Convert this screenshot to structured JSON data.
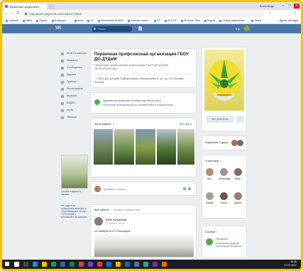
{
  "browser": {
    "tab_title": "Первичная профсоюзн...",
    "user_chip": "Александр",
    "win_min": "–",
    "win_max": "□",
    "win_close": "✕",
    "back": "←",
    "forward": "→",
    "reload": "C",
    "secure_label": "Надежный",
    "url": "https://vk.com/club44774618",
    "star": "☆",
    "menu": "⋮",
    "bookmarks": [
      "Сервисы",
      "Netflix",
      "Яндекс",
      "Входящие - ...",
      "почта",
      "VK",
      "Накопление Кешбэк",
      "Главная страни...",
      "РФ",
      "ФНС РФ",
      "Интернет-банк",
      "Яндекс",
      "Общая завершение ...",
      "Лицей"
    ],
    "bookmarks_other": "Другие закладки"
  },
  "vk_header": {
    "logo": "VK",
    "search_placeholder": "Поиск",
    "user_name": "Юр"
  },
  "left_nav": [
    {
      "label": "Моя Страница"
    },
    {
      "label": "Новости"
    },
    {
      "label": "Сообщения"
    },
    {
      "label": "Друзья"
    },
    {
      "label": "Группы"
    },
    {
      "label": "Фотографии"
    },
    {
      "label": "Музыка"
    },
    {
      "label": "Видео"
    },
    {
      "label": "Игры"
    },
    {
      "label": "Товары"
    }
  ],
  "left_ads": {
    "ad1_text": "Служба в армии в Энском",
    "ad2_text": "Не ходите на пенсионные выплаты в с восемнадцать. Более 7000 пенсии с доставкой и на копилке"
  },
  "group": {
    "name": "Первичная профсоюзная организация ГБОУ ДО ДТДиМ",
    "subtitle": "Первичная профсоюзная организация ГБОУ ДО ДТДиМ \"ИНФОРМАТИКА\"",
    "address": "ГБОУ ДО ДТДиМ Темиргоевска, Масальская Б. ул., д. 14, Москва, Россия",
    "admin_notice": "Администрирование сообщества ВКонтакте",
    "admin_notice_sub": "Полезная информация по управлению сообществом",
    "photos_label": "Фотографии",
    "photos_count": "5",
    "photos_all": "все фото",
    "post_placeholder": "Добавить запись...",
    "tabs_all": "Все записи",
    "tabs_search": "Записи сообщества",
    "post_author": "Юля Новикова",
    "post_date": "12 июля в 10:16",
    "post_text": "15 ноября 2017г. Пленарна"
  },
  "right": {
    "button_label": "Вы участник",
    "more_label": "···",
    "contacts_label": "Подписаны 2 друга",
    "members_label": "Участники",
    "members_count": "5",
    "members": [
      {
        "name": "Ира"
      },
      {
        "name": "Александр"
      },
      {
        "name": "Вера"
      },
      {
        "name": "Софья"
      },
      {
        "name": "Ольга"
      },
      {
        "name": "Ирина"
      }
    ],
    "links_label": "Ссылки",
    "links_count": "1",
    "link_title": "Профсоюз",
    "link_desc": "Московская городская организация Профсоюза"
  },
  "taskbar": {
    "time": "15:45",
    "date": "17.07.2017"
  },
  "colors": {
    "vk_blue": "#4a76a8",
    "frame": "#f3c400",
    "background": "#edeef0"
  }
}
